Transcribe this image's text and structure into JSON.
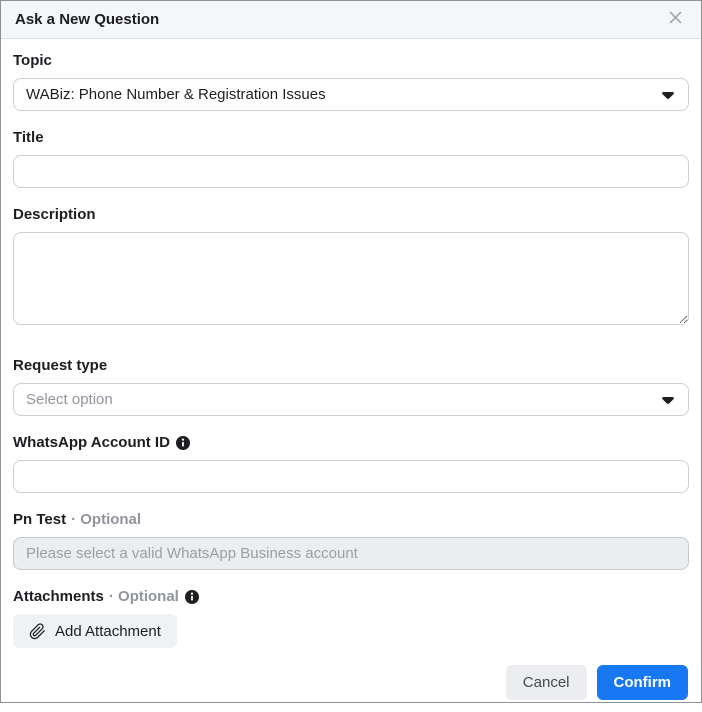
{
  "modal": {
    "title": "Ask a New Question"
  },
  "form": {
    "topic": {
      "label": "Topic",
      "value": "WABiz: Phone Number & Registration Issues"
    },
    "title": {
      "label": "Title",
      "value": ""
    },
    "description": {
      "label": "Description",
      "value": ""
    },
    "request_type": {
      "label": "Request type",
      "placeholder": "Select option"
    },
    "whatsapp_account_id": {
      "label": "WhatsApp Account ID",
      "value": ""
    },
    "pn_test": {
      "label": "Pn Test",
      "optional_label": "· Optional",
      "placeholder": "Please select a valid WhatsApp Business account",
      "disabled": true
    },
    "attachments": {
      "label": "Attachments",
      "optional_label": "· Optional",
      "add_button_label": "Add Attachment"
    }
  },
  "footer": {
    "cancel_label": "Cancel",
    "confirm_label": "Confirm"
  },
  "colors": {
    "accent": "#1877f2",
    "label_text": "#1c1e21",
    "secondary_text": "#90949c",
    "input_border": "#ccd0d5",
    "header_bg": "#f5f6f7",
    "disabled_bg": "#ebedef"
  },
  "icons": {
    "close": "✕",
    "dropdown_caret": "▼",
    "info": "ℹ",
    "paperclip": "📎"
  }
}
